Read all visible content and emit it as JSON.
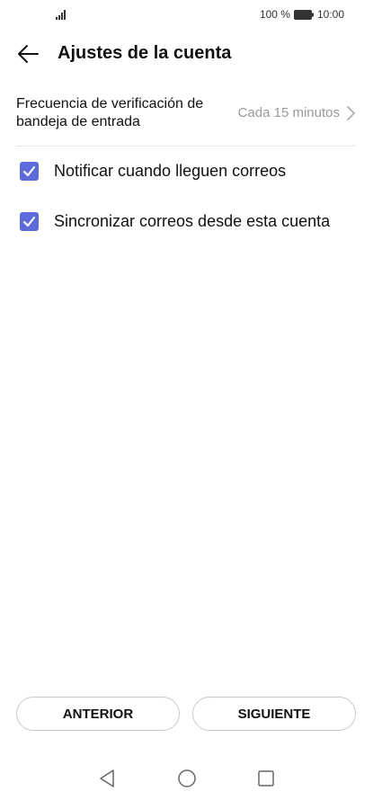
{
  "status_bar": {
    "battery_percent": "100 %",
    "time": "10:00",
    "icons": [
      "signal-icon",
      "battery-icon"
    ]
  },
  "header": {
    "title": "Ajustes de la cuenta",
    "back_icon": "arrow-left-icon"
  },
  "settings": {
    "frequency": {
      "label": "Frecuencia de verificación de bandeja de entrada",
      "value": "Cada 15 minutos"
    },
    "notify": {
      "label": "Notificar cuando lleguen correos",
      "checked": true
    },
    "sync": {
      "label": "Sincronizar correos desde esta cuenta",
      "checked": true
    }
  },
  "buttons": {
    "previous": "ANTERIOR",
    "next": "SIGUIENTE"
  },
  "nav_bar": {
    "icons": [
      "nav-back-icon",
      "nav-home-icon",
      "nav-recent-icon"
    ]
  },
  "colors": {
    "accent": "#5b6bd9",
    "secondary_text": "#999999",
    "divider": "#e6e6e6"
  }
}
